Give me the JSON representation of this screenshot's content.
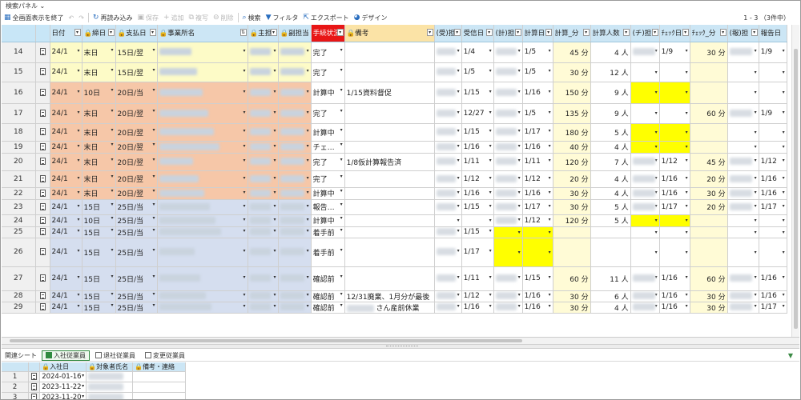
{
  "panel": {
    "title": "検索パネル ⌄"
  },
  "toolbar": {
    "exit_fullscreen": "全画面表示を終了",
    "undo": "↶",
    "redo": "↷",
    "reload": "再読み込み",
    "save": "保存",
    "add": "追加",
    "duplicate": "複写",
    "delete": "削除",
    "search": "検索",
    "filter": "フィルタ",
    "export": "エクスポート",
    "design": "デザイン",
    "record_count": "1 - 3 （3件中）"
  },
  "columns": [
    "日付",
    "締日",
    "支払日",
    "事業所名",
    "主担",
    "副担当",
    "手続状況",
    "備考",
    "(受)担",
    "受信日",
    "(計)担",
    "計算日",
    "計算_分",
    "計算人数",
    "(チ)担",
    "ﾁｪｯｸ日",
    "ﾁｪｯｸ_分",
    "(報)担",
    "報告日"
  ],
  "rows": [
    {
      "n": "14",
      "date": "24/1",
      "close": "末日",
      "pay": "15日/翌",
      "status": "完了",
      "note": "",
      "recv": "1/4",
      "calc": "1/5",
      "calc_min": "45 分",
      "calc_cnt": "4 人",
      "chk": "1/9",
      "chk_min": "30 分",
      "rep": "1/9"
    },
    {
      "n": "15",
      "date": "24/1",
      "close": "末日",
      "pay": "15日/翌",
      "status": "完了",
      "note": "",
      "recv": "1/5",
      "calc": "1/5",
      "calc_min": "30 分",
      "calc_cnt": "12 人",
      "chk": "",
      "chk_min": "",
      "rep": ""
    },
    {
      "n": "16",
      "date": "24/1",
      "close": "10日",
      "pay": "20日/当",
      "status": "計算中",
      "note": "1/15資料督促",
      "recv": "1/15",
      "calc": "1/16",
      "calc_min": "150 分",
      "calc_cnt": "9 人",
      "chk": "",
      "chk_min": "",
      "rep": ""
    },
    {
      "n": "17",
      "date": "24/1",
      "close": "末日",
      "pay": "20日/翌",
      "status": "完了",
      "note": "",
      "recv": "12/27",
      "calc": "1/5",
      "calc_min": "135 分",
      "calc_cnt": "9 人",
      "chk": "",
      "chk_min": "60 分",
      "rep": "1/9"
    },
    {
      "n": "18",
      "date": "24/1",
      "close": "末日",
      "pay": "20日/翌",
      "status": "計算中",
      "note": "",
      "recv": "1/15",
      "calc": "1/17",
      "calc_min": "180 分",
      "calc_cnt": "5 人",
      "chk": "",
      "chk_min": "",
      "rep": ""
    },
    {
      "n": "19",
      "date": "24/1",
      "close": "末日",
      "pay": "20日/翌",
      "status": "チェ…",
      "note": "",
      "recv": "1/16",
      "calc": "1/16",
      "calc_min": "40 分",
      "calc_cnt": "4 人",
      "chk": "",
      "chk_min": "",
      "rep": ""
    },
    {
      "n": "20",
      "date": "24/1",
      "close": "末日",
      "pay": "20日/翌",
      "status": "完了",
      "note": "1/8仮計算報告済",
      "recv": "1/11",
      "calc": "1/11",
      "calc_min": "120 分",
      "calc_cnt": "7 人",
      "chk": "1/12",
      "chk_min": "45 分",
      "rep": "1/12"
    },
    {
      "n": "21",
      "date": "24/1",
      "close": "末日",
      "pay": "20日/翌",
      "status": "完了",
      "note": "",
      "recv": "1/12",
      "calc": "1/12",
      "calc_min": "20 分",
      "calc_cnt": "4 人",
      "chk": "1/16",
      "chk_min": "20 分",
      "rep": "1/16"
    },
    {
      "n": "22",
      "date": "24/1",
      "close": "末日",
      "pay": "20日/翌",
      "status": "計算中",
      "note": "",
      "recv": "1/16",
      "calc": "1/16",
      "calc_min": "30 分",
      "calc_cnt": "4 人",
      "chk": "1/16",
      "chk_min": "30 分",
      "rep": "1/16"
    },
    {
      "n": "23",
      "date": "24/1",
      "close": "15日",
      "pay": "25日/当",
      "status": "報告…",
      "note": "",
      "recv": "1/15",
      "calc": "1/17",
      "calc_min": "30 分",
      "calc_cnt": "5 人",
      "chk": "1/17",
      "chk_min": "20 分",
      "rep": "1/17"
    },
    {
      "n": "24",
      "date": "24/1",
      "close": "10日",
      "pay": "25日/当",
      "status": "計算中",
      "note": "",
      "recv": "",
      "calc": "1/12",
      "calc_min": "120 分",
      "calc_cnt": "5 人",
      "chk": "",
      "chk_min": "",
      "rep": ""
    },
    {
      "n": "25",
      "date": "24/1",
      "close": "15日",
      "pay": "25日/当",
      "status": "着手前",
      "note": "",
      "recv": "1/15",
      "calc": "",
      "calc_min": "",
      "calc_cnt": "",
      "chk": "",
      "chk_min": "",
      "rep": ""
    },
    {
      "n": "26",
      "date": "24/1",
      "close": "15日",
      "pay": "25日/当",
      "status": "着手前",
      "note": "",
      "recv": "1/17",
      "calc": "",
      "calc_min": "",
      "calc_cnt": "",
      "chk": "",
      "chk_min": "",
      "rep": ""
    },
    {
      "n": "27",
      "date": "24/1",
      "close": "15日",
      "pay": "25日/当",
      "status": "確認前",
      "note": "",
      "recv": "1/11",
      "calc": "1/15",
      "calc_min": "60 分",
      "calc_cnt": "11 人",
      "chk": "1/16",
      "chk_min": "60 分",
      "rep": "1/16"
    },
    {
      "n": "28",
      "date": "24/1",
      "close": "15日",
      "pay": "25日/当",
      "status": "確認前",
      "note": "12/31廃業、1月分が最後",
      "recv": "1/12",
      "calc": "1/16",
      "calc_min": "30 分",
      "calc_cnt": "6 人",
      "chk": "1/16",
      "chk_min": "30 分",
      "rep": "1/16"
    },
    {
      "n": "29",
      "date": "24/1",
      "close": "15日",
      "pay": "25日/当",
      "status": "確認前",
      "note": "さん産前休業",
      "recv": "1/16",
      "calc": "1/16",
      "calc_min": "30 分",
      "calc_cnt": "4 人",
      "chk": "1/16",
      "chk_min": "30 分",
      "rep": "1/17"
    }
  ],
  "bottom": {
    "label": "関連シート",
    "tabs": [
      "入社従業員",
      "退社従業員",
      "変更従業員"
    ],
    "toggle": "▼"
  },
  "subgrid": {
    "columns": [
      "入社日",
      "対象者氏名",
      "備考・連絡"
    ],
    "rows": [
      {
        "n": "1",
        "date": "2024-01-16"
      },
      {
        "n": "2",
        "date": "2023-11-22"
      },
      {
        "n": "3",
        "date": "2023-11-20"
      }
    ]
  },
  "colors": {
    "yellow_row": "#fdfbc7",
    "orange_row": "#f6c7a8",
    "blue_row": "#d5deef",
    "highlight": "#ffff00",
    "status_header": "#e81616",
    "header": "#cce6f5"
  }
}
